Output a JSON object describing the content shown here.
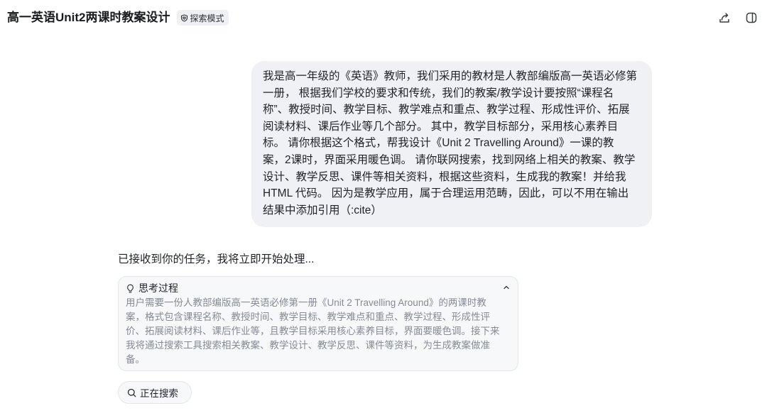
{
  "header": {
    "title": "高一英语Unit2两课时教案设计",
    "mode_badge": {
      "icon": "shield-icon",
      "label": "探索模式"
    },
    "actions": [
      {
        "icon": "share-icon"
      },
      {
        "icon": "sidebar-toggle-icon"
      }
    ]
  },
  "conversation": {
    "user_message": {
      "lines": [
        "我是高一年级的《英语》教师，我们采用的教材是人教部编版高一英语必修第",
        "一册， 根据我们学校的要求和传统，我们的教案/教学设计要按照“课程名",
        "称”、教授时间、教学目标、教学难点和重点、教学过程、形成性评价、拓展",
        "阅读材料、课后作业等几个部分。 其中，教学目标部分，采用核心素养目",
        "标。 请你根据这个格式，帮我设计《Unit 2 Travelling Around》一课的教",
        "案，2课时，界面采用暖色调。 请你联网搜索，找到网络上相关的教案、教学",
        "设计、教学反思、课件等相关资料，根据这些资料，生成我的教案！并给我",
        "HTML 代码。 因为是教学应用，属于合理运用范畴，因此，可以不用在输出",
        "结果中添加引用（:cite）"
      ]
    },
    "assistant": {
      "ack_text": "已接收到你的任务，我将立即开始处理...",
      "thinking": {
        "icon": "lightbulb-icon",
        "title": "思考过程",
        "toggle_icon": "chevron-up-icon",
        "lines": [
          "用户需要一份人教部编版高一英语必修第一册《Unit 2 Travelling Around》的两课时教",
          "案，格式包含课程名称、教授时间、教学目标、教学难点和重点、教学过程、形成性评",
          "价、拓展阅读材料、课后作业等，且教学目标采用核心素养目标，界面要暖色调。接下来",
          "我将通过搜索工具搜索相关教案、教学设计、教学反思、课件等资料，为生成教案做准",
          "备。"
        ]
      },
      "status_pill": {
        "icon": "search-icon",
        "label": "正在搜索"
      }
    }
  },
  "colors": {
    "background": "#ffffff",
    "text_primary": "#1f2329",
    "text_secondary": "#868b94",
    "user_bubble_bg": "#f0f1f5",
    "panel_bg": "#f7f8fa",
    "panel_border": "#e4e6eb",
    "badge_bg": "#eef0f3"
  }
}
